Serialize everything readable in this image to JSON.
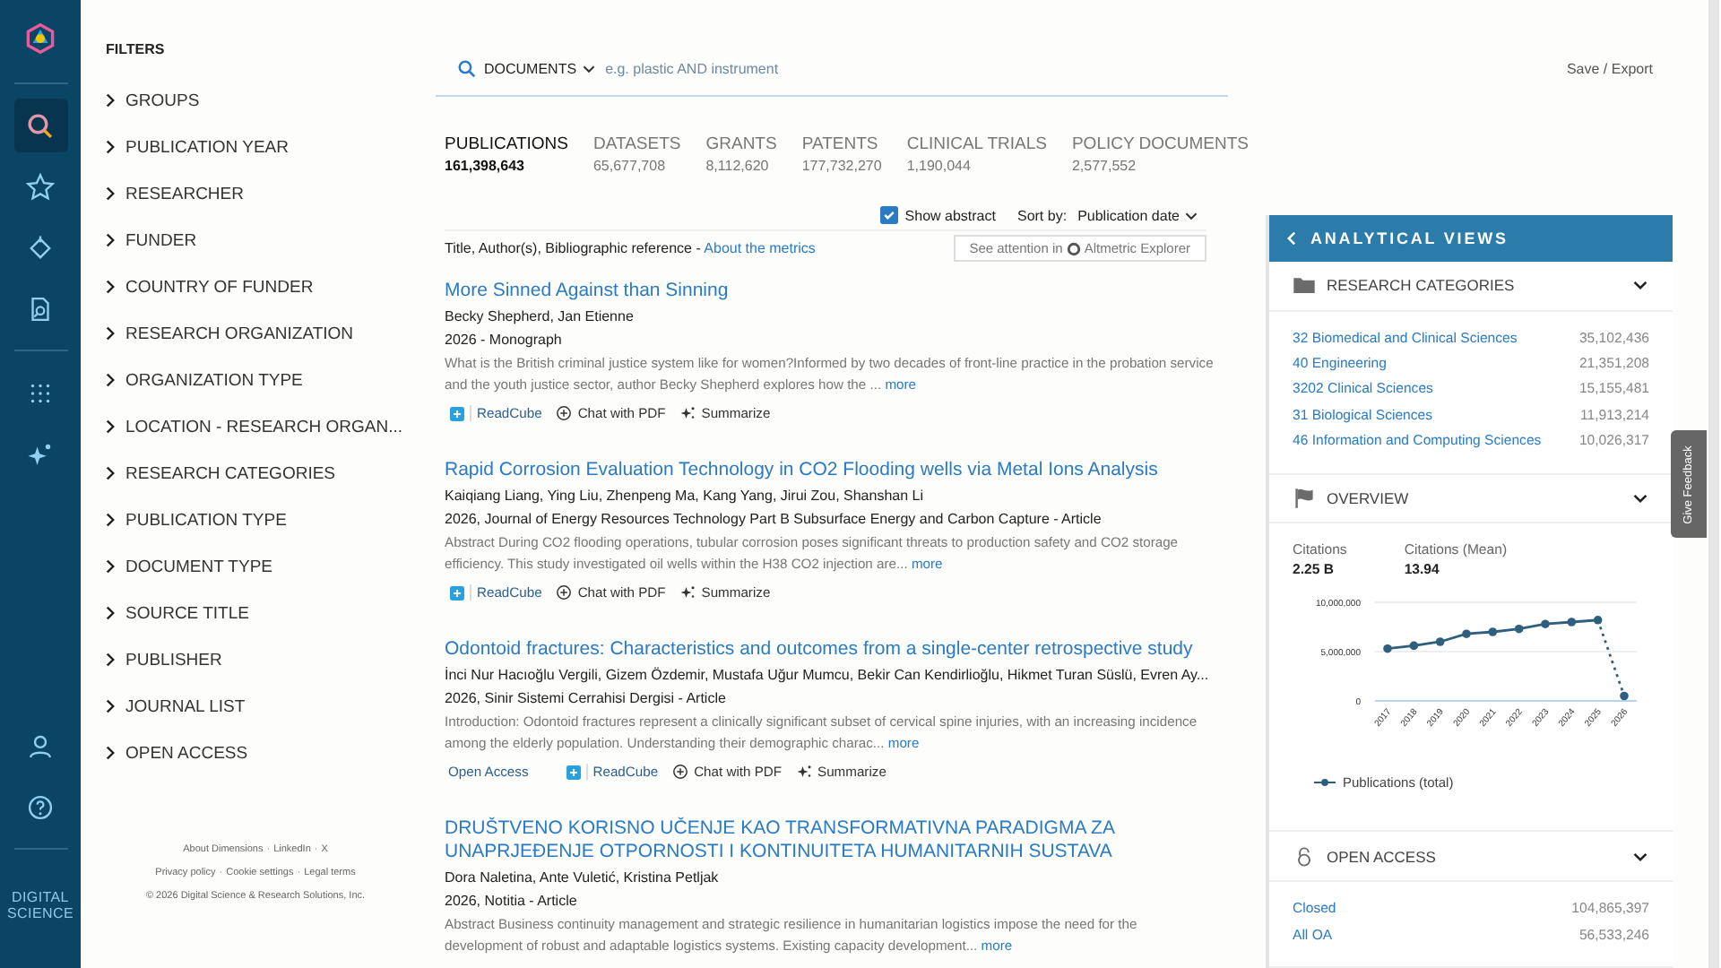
{
  "rail": {
    "items": [
      {
        "selected": true
      },
      {
        "selected": false
      },
      {
        "selected": false
      },
      {
        "selected": false
      },
      {
        "selected": false
      },
      {
        "selected": false
      }
    ],
    "brand": [
      "DIGITAL",
      "SCIENCE"
    ]
  },
  "filters": {
    "title": "FILTERS",
    "items": [
      "GROUPS",
      "PUBLICATION YEAR",
      "RESEARCHER",
      "FUNDER",
      "COUNTRY OF FUNDER",
      "RESEARCH ORGANIZATION",
      "ORGANIZATION TYPE",
      "LOCATION - RESEARCH ORGAN...",
      "RESEARCH CATEGORIES",
      "PUBLICATION TYPE",
      "DOCUMENT TYPE",
      "SOURCE TITLE",
      "PUBLISHER",
      "JOURNAL LIST",
      "OPEN ACCESS"
    ],
    "separator": "·",
    "footer": [
      [
        "About Dimensions",
        "LinkedIn",
        "X"
      ],
      [
        "Privacy policy",
        "Cookie settings",
        "Legal terms"
      ]
    ],
    "copyright": "© 2026 Digital Science & Research Solutions, Inc."
  },
  "search": {
    "scope": "DOCUMENTS",
    "placeholder": "e.g. plastic AND instrument",
    "save_export": "Save / Export"
  },
  "tabs": [
    {
      "label": "PUBLICATIONS",
      "count": "161,398,643",
      "selected": true
    },
    {
      "label": "DATASETS",
      "count": "65,677,708",
      "selected": false
    },
    {
      "label": "GRANTS",
      "count": "8,112,620",
      "selected": false
    },
    {
      "label": "PATENTS",
      "count": "177,732,270",
      "selected": false
    },
    {
      "label": "CLINICAL TRIALS",
      "count": "1,190,044",
      "selected": false
    },
    {
      "label": "POLICY DOCUMENTS",
      "count": "2,577,552",
      "selected": false
    }
  ],
  "options": {
    "show_abstract": {
      "label": "Show abstract",
      "checked": true
    },
    "sort_label": "Sort by:",
    "sort_value": "Publication date"
  },
  "list_header": {
    "text": "Title, Author(s), Bibliographic reference - ",
    "link": "About the metrics",
    "attention": "See attention in",
    "attention_source": "Altmetric Explorer"
  },
  "results": [
    {
      "title": "More Sinned Against than Sinning",
      "authors": "Becky Shepherd, Jan Etienne",
      "reference": "2026 - Monograph",
      "abstract": "What is the British criminal justice system like for women?Informed by two decades of front-line practice in the probation service and the youth justice sector, author Becky Shepherd explores how the ...",
      "more": "more",
      "open_access": false,
      "actions": [
        "ReadCube",
        "Chat with PDF",
        "Summarize"
      ]
    },
    {
      "title": "Rapid Corrosion Evaluation Technology in CO2 Flooding wells via Metal Ions Analysis",
      "authors": "Kaiqiang Liang, Ying Liu, Zhenpeng Ma, Kang Yang, Jirui Zou, Shanshan Li",
      "reference": "2026, Journal of Energy Resources Technology Part B Subsurface Energy and Carbon Capture - Article",
      "abstract": "Abstract During CO2 flooding operations, tubular corrosion poses significant threats to production safety and CO2 storage efficiency. This study investigated oil wells within the H38 CO2 injection are...",
      "more": "more",
      "open_access": false,
      "actions": [
        "ReadCube",
        "Chat with PDF",
        "Summarize"
      ]
    },
    {
      "title": "Odontoid fractures: Characteristics and outcomes from a single-center retrospective study",
      "authors": "İnci Nur Hacıoğlu Vergili, Gizem Özdemir, Mustafa Uğur Mumcu, Bekir Can Kendirlioğlu, Hikmet Turan Süslü, Evren Ay...",
      "reference": "2026, Sinir Sistemi Cerrahisi Dergisi - Article",
      "abstract": "Introduction: Odontoid fractures represent a clinically significant subset of cervical spine injuries, with an increasing incidence among the elderly population. Understanding their demographic charac...",
      "more": "more",
      "open_access": true,
      "open_access_label": "Open Access",
      "actions": [
        "ReadCube",
        "Chat with PDF",
        "Summarize"
      ]
    },
    {
      "title": "DRUŠTVENO KORISNO UČENJE KAO TRANSFORMATIVNA PARADIGMA ZA UNAPRJEĐENJE OTPORNOSTI I KONTINUITETA HUMANITARNIH SUSTAVA",
      "authors": "Dora Naletina, Ante Vuletić, Kristina Petljak",
      "reference": "2026, Notitia - Article",
      "abstract": "Abstract Business continuity management and strategic resilience in humanitarian logistics impose the need for the development of robust and adaptable logistics systems. Existing capacity development...",
      "more": "more",
      "open_access": false
    }
  ],
  "panel": {
    "title": "ANALYTICAL VIEWS",
    "sections": [
      {
        "kind": "list",
        "title": "RESEARCH CATEGORIES",
        "expanded": true,
        "rows": [
          {
            "label": "32 Biomedical and Clinical Sciences",
            "value": "35,102,436"
          },
          {
            "label": "40 Engineering",
            "value": "21,351,208"
          },
          {
            "label": "3202 Clinical Sciences",
            "value": "15,155,481"
          },
          {
            "label": "31 Biological Sciences",
            "value": "11,913,214"
          },
          {
            "label": "46 Information and Computing Sciences",
            "value": "10,026,317"
          }
        ]
      },
      {
        "kind": "chart",
        "title": "OVERVIEW",
        "expanded": true,
        "stats": [
          {
            "label": "Citations",
            "value": "2.25 B"
          },
          {
            "label": "Citations (Mean)",
            "value": "13.94"
          }
        ],
        "chart_data": {
          "type": "line",
          "x": [
            "2017",
            "2018",
            "2019",
            "2020",
            "2021",
            "2022",
            "2023",
            "2024",
            "2025",
            "2026"
          ],
          "series": [
            {
              "name": "Publications (total)",
              "color": "#2e5f7f",
              "marker": "circle",
              "values": [
                5300000,
                5600000,
                6000000,
                6800000,
                7000000,
                7300000,
                7800000,
                8000000,
                8200000,
                500000
              ]
            }
          ],
          "ylim": [
            0,
            10000000
          ],
          "yticks": [
            {
              "value": 0,
              "label": "0"
            },
            {
              "value": 5000000,
              "label": "5,000,000"
            },
            {
              "value": 10000000,
              "label": "10,000,000"
            }
          ]
        }
      },
      {
        "kind": "list",
        "title": "OPEN ACCESS",
        "expanded": true,
        "rows": [
          {
            "label": "Closed",
            "value": "104,865,397"
          },
          {
            "label": "All OA",
            "value": "56,533,246"
          }
        ]
      }
    ]
  },
  "feedback": "Give Feedback"
}
